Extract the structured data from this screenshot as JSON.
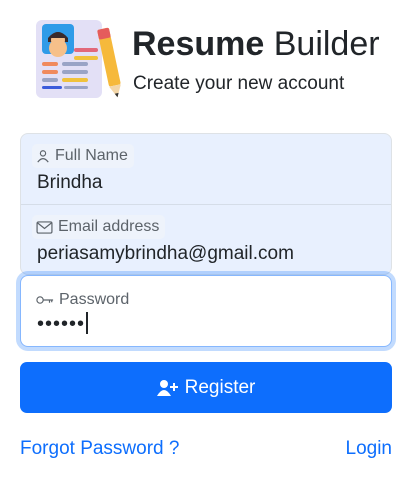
{
  "header": {
    "title_bold": "Resume",
    "title_rest": "Builder",
    "subtitle": "Create your new account",
    "logo_icon": "resume-document-pencil-icon"
  },
  "form": {
    "fullname": {
      "label": "Full Name",
      "value": "Brindha",
      "icon": "person-icon"
    },
    "email": {
      "label": "Email address",
      "value": "periasamybrindha@gmail.com",
      "icon": "envelope-icon"
    },
    "password": {
      "label": "Password",
      "value": "••••••",
      "icon": "key-icon"
    }
  },
  "actions": {
    "register_label": "Register",
    "register_icon": "person-add-icon",
    "forgot_label": "Forgot Password ?",
    "login_label": "Login"
  },
  "colors": {
    "primary": "#0d6efd",
    "field_bg": "#e8f0fe",
    "focus_border": "#86b7fe"
  }
}
